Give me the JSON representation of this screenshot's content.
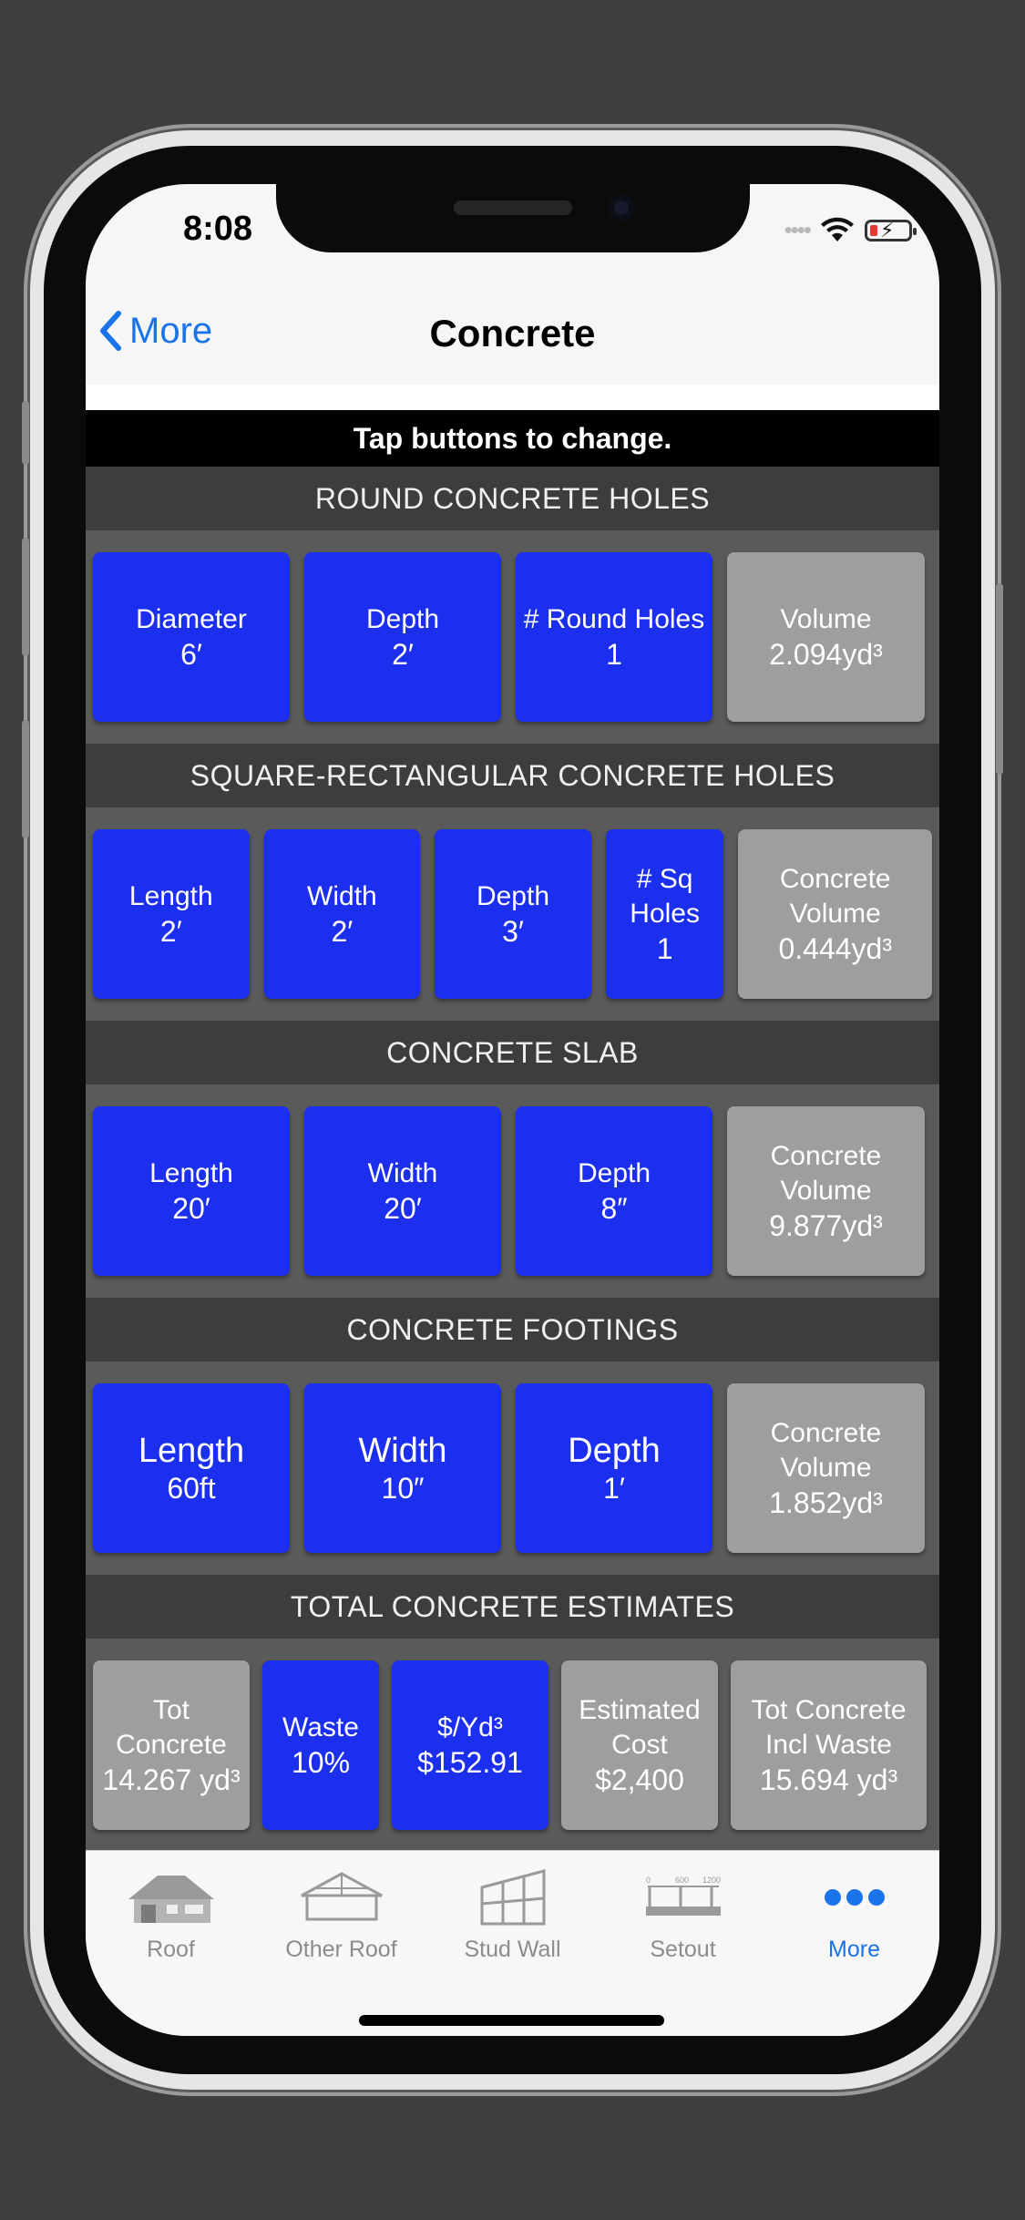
{
  "status": {
    "time": "8:08"
  },
  "nav": {
    "back_label": "More",
    "title": "Concrete"
  },
  "hint": "Tap buttons to change.",
  "sections": {
    "round": {
      "title": "ROUND CONCRETE HOLES",
      "diameter": {
        "label": "Diameter",
        "value": "6′"
      },
      "depth": {
        "label": "Depth",
        "value": "2′"
      },
      "holes": {
        "label": "# Round Holes",
        "value": "1"
      },
      "volume": {
        "label": "Volume",
        "value": "2.094yd³"
      }
    },
    "square": {
      "title": "SQUARE-RECTANGULAR  CONCRETE HOLES",
      "length": {
        "label": "Length",
        "value": "2′"
      },
      "width": {
        "label": "Width",
        "value": "2′"
      },
      "depth": {
        "label": "Depth",
        "value": "3′"
      },
      "holes": {
        "label1": "# Sq",
        "label2": "Holes",
        "value": "1"
      },
      "volume": {
        "label1": "Concrete",
        "label2": "Volume",
        "value": "0.444yd³"
      }
    },
    "slab": {
      "title": "CONCRETE SLAB",
      "length": {
        "label": "Length",
        "value": "20′"
      },
      "width": {
        "label": "Width",
        "value": "20′"
      },
      "depth": {
        "label": "Depth",
        "value": "8″"
      },
      "volume": {
        "label1": "Concrete",
        "label2": "Volume",
        "value": "9.877yd³"
      }
    },
    "footings": {
      "title": "CONCRETE FOOTINGS",
      "length": {
        "label": "Length",
        "value": "60ft"
      },
      "width": {
        "label": "Width",
        "value": "10″"
      },
      "depth": {
        "label": "Depth",
        "value": "1′"
      },
      "volume": {
        "label1": "Concrete",
        "label2": "Volume",
        "value": "1.852yd³"
      }
    },
    "total": {
      "title": "TOTAL CONCRETE ESTIMATES",
      "tot": {
        "label1": "Tot",
        "label2": "Concrete",
        "value": "14.267 yd³"
      },
      "waste": {
        "label": "Waste",
        "value": "10%"
      },
      "price": {
        "label": "$/Yd³",
        "value": "$152.91"
      },
      "cost": {
        "label1": "Estimated",
        "label2": "Cost",
        "value": "$2,400"
      },
      "incl": {
        "label1": "Tot Concrete",
        "label2": "Incl Waste",
        "value": "15.694 yd³"
      }
    }
  },
  "tabs": [
    {
      "label": "Roof",
      "icon": "house-roof-icon"
    },
    {
      "label": "Other Roof",
      "icon": "gable-roof-icon"
    },
    {
      "label": "Stud Wall",
      "icon": "stud-wall-icon"
    },
    {
      "label": "Setout",
      "icon": "setout-ruler-icon"
    },
    {
      "label": "More",
      "icon": "more-dots-icon"
    }
  ],
  "setout_icon_text": {
    "a": "0",
    "b": "600",
    "c": "1200"
  },
  "colors": {
    "tile_blue": "#1c2eee",
    "tile_gray": "#9e9e9e",
    "accent": "#1a73e8"
  }
}
